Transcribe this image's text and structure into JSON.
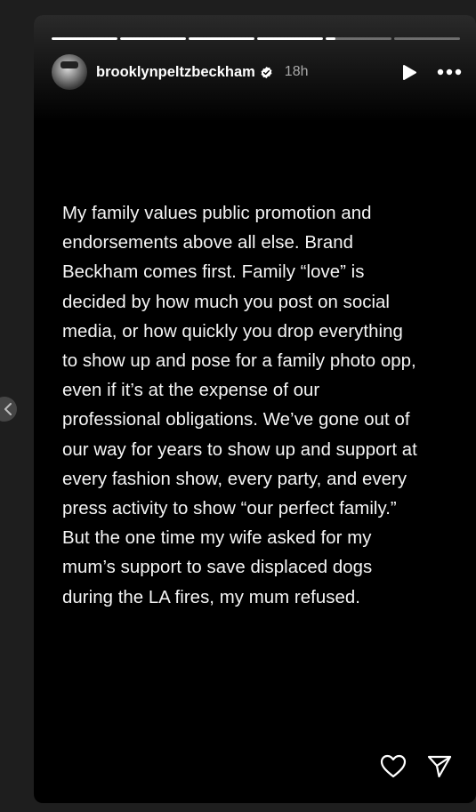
{
  "story": {
    "username": "brooklynpeltzbeckham",
    "timestamp": "18h",
    "verified": true,
    "progress": [
      1,
      1,
      1,
      1,
      0.15,
      0
    ],
    "text": "My family values public promotion and\nendorsements above all else. Brand\nBeckham comes first. Family “love” is\ndecided by how much you post on social\nmedia, or how quickly you drop everything\nto show up and pose for a family photo opp,\neven if it’s at the expense of our\nprofessional obligations. We’ve gone out of\nour way for years to show up and support at\nevery fashion show, every party, and every\npress activity to show “our perfect family.”\nBut the one time my wife asked for my\nmum’s support to save displaced dogs\nduring the LA fires, my mum refused."
  },
  "icons": {
    "prev": "chevron-left-icon",
    "verified": "verified-badge-icon",
    "play": "play-icon",
    "more": "more-horizontal-icon",
    "like": "heart-icon",
    "share": "send-icon"
  },
  "colors": {
    "background": "#1e1e1e",
    "story_background": "#000000",
    "text": "#f5f5f5",
    "timestamp": "#a8a8a8",
    "progress_active": "#ffffff",
    "progress_inactive": "rgba(255,255,255,0.35)"
  }
}
